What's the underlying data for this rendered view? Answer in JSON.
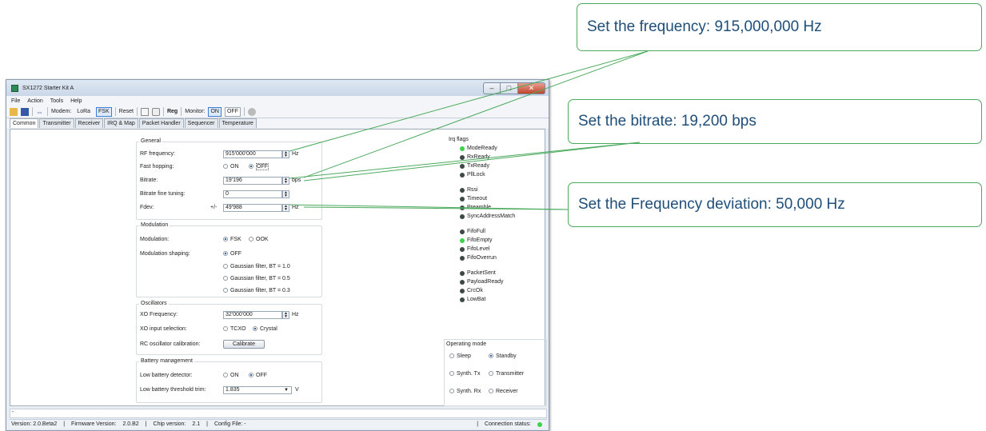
{
  "callouts": {
    "frequency": "Set the frequency: 915,000,000 Hz",
    "bitrate": "Set the bitrate: 19,200 bps",
    "fdev": "Set the Frequency deviation: 50,000 Hz"
  },
  "window": {
    "title": "SX1272 Starter Kit A",
    "min": "–",
    "max": "□",
    "close": "✕"
  },
  "menu": [
    "File",
    "Action",
    "Tools",
    "Help"
  ],
  "toolbar": {
    "modem_label": "Modem:",
    "lora": "LoRa",
    "fsk": "FSK",
    "reset": "Reset",
    "reg": "Reg",
    "monitor_label": "Monitor:",
    "on": "ON",
    "off": "OFF"
  },
  "tabs": [
    "Common",
    "Transmitter",
    "Receiver",
    "IRQ & Map",
    "Packet Handler",
    "Sequencer",
    "Temperature"
  ],
  "general": {
    "title": "General",
    "rf_label": "RF frequency:",
    "rf_value": "915'000'000",
    "rf_unit": "Hz",
    "fast_label": "Fast hopping:",
    "fast_on": "ON",
    "fast_off": "OFF",
    "bitrate_label": "Bitrate:",
    "bitrate_value": "19'196",
    "bitrate_unit": "bps",
    "fine_label": "Bitrate fine tuning:",
    "fine_value": "0",
    "fdev_label": "Fdev:",
    "fdev_pm": "+/-",
    "fdev_value": "49'988",
    "fdev_unit": "Hz"
  },
  "modulation": {
    "title": "Modulation",
    "mod_label": "Modulation:",
    "fsk": "FSK",
    "ook": "OOK",
    "shaping_label": "Modulation shaping:",
    "shaping": [
      "OFF",
      "Gaussian filter, BT = 1.0",
      "Gaussian filter, BT = 0.5",
      "Gaussian filter, BT = 0.3"
    ]
  },
  "oscillators": {
    "title": "Oscillators",
    "xo_label": "XO Frequency:",
    "xo_value": "32'000'000",
    "xo_unit": "Hz",
    "xo_sel_label": "XO input selection:",
    "tcxo": "TCXO",
    "crystal": "Crystal",
    "rc_label": "RC oscillator calibration:",
    "calibrate": "Calibrate"
  },
  "battery": {
    "title": "Battery management",
    "det_label": "Low battery detector:",
    "on": "ON",
    "off": "OFF",
    "trim_label": "Low battery threshold trim:",
    "trim_value": "1.835",
    "trim_unit": "V"
  },
  "irq": {
    "title": "Irq flags",
    "flags": [
      {
        "name": "ModeReady",
        "active": true
      },
      {
        "name": "RxReady",
        "active": false
      },
      {
        "name": "TxReady",
        "active": false
      },
      {
        "name": "PllLock",
        "active": false
      },
      {
        "name": "Rssi",
        "active": false
      },
      {
        "name": "Timeout",
        "active": false
      },
      {
        "name": "Preamble",
        "active": false
      },
      {
        "name": "SyncAddressMatch",
        "active": false
      },
      {
        "name": "FifoFull",
        "active": false
      },
      {
        "name": "FifoEmpty",
        "active": true
      },
      {
        "name": "FifoLevel",
        "active": false
      },
      {
        "name": "FifoOverrun",
        "active": false
      },
      {
        "name": "PacketSent",
        "active": false
      },
      {
        "name": "PayloadReady",
        "active": false
      },
      {
        "name": "CrcOk",
        "active": false
      },
      {
        "name": "LowBat",
        "active": false
      }
    ]
  },
  "opmode": {
    "title": "Operating mode",
    "sleep": "Sleep",
    "standby": "Standby",
    "synth_tx": "Synth. Tx",
    "transmitter": "Transmitter",
    "synth_rx": "Synth. Rx",
    "receiver": "Receiver"
  },
  "log": "-",
  "status": {
    "version": "Version: 2.0.Beta2",
    "fw_label": "Firmware Version:",
    "fw_value": "2.0.B2",
    "chip_label": "Chip version:",
    "chip_value": "2.1",
    "config": "Config File: -",
    "conn": "Connection status:"
  },
  "colors": {
    "callout_border": "#4caa5e",
    "callout_text": "#1f4e79",
    "led_on": "#3fd24b",
    "led_off": "#3d4a44"
  }
}
